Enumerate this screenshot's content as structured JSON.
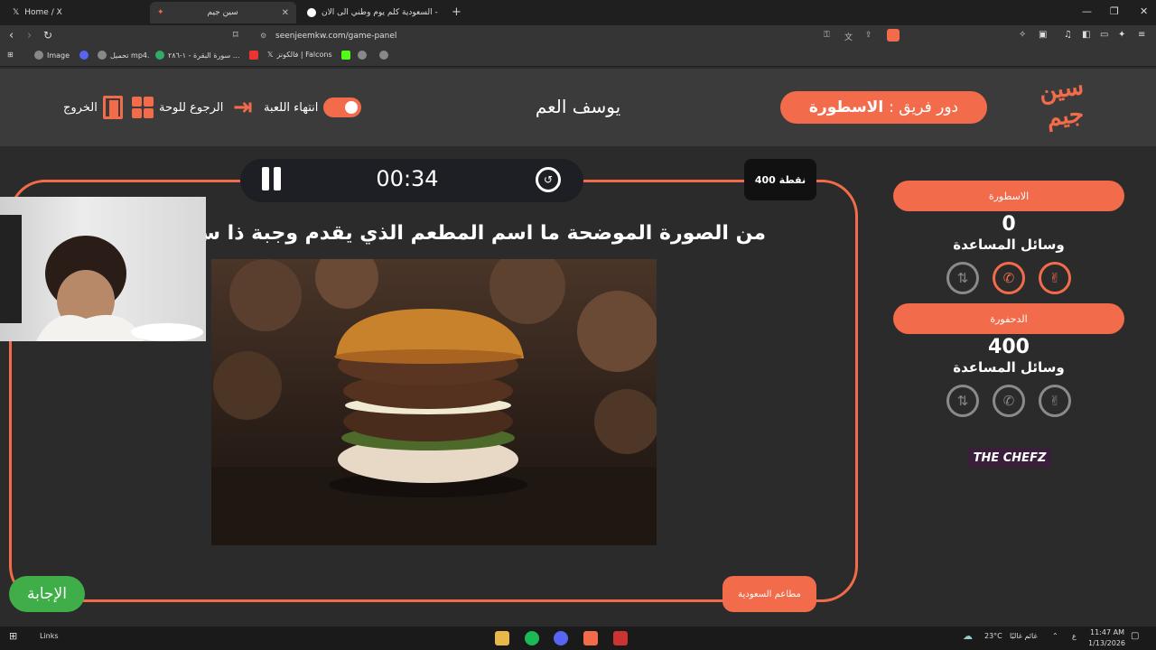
{
  "browser": {
    "tabs": [
      {
        "label": "Home / X"
      },
      {
        "label": "سين جيم",
        "close": "✕"
      },
      {
        "label": "السعودية كلم يوم وطني الى الان - rch",
        "close": "✕"
      }
    ],
    "new_tab": "+",
    "url": "seenjeemkw.com/game-panel",
    "bookmarks": [
      "Image",
      "تحميل mp4.",
      "سورة البقرة - ١-٢٨٦ ...",
      "فالكونز | Falcons"
    ]
  },
  "header": {
    "logo_line1": "سين",
    "logo_line2": "جيم",
    "turn_prefix": "دور فريق :",
    "turn_team": "الاسطورة",
    "player_name": "يوسف العم",
    "end_game_label": "انتهاء اللعبة",
    "back_to_board_label": "الرجوع للوحة",
    "exit_label": "الخروج"
  },
  "question_panel": {
    "timer": "00:34",
    "points": "400 نقطة",
    "question": "من الصورة الموضحة ما اسم المطعم الذي يقدم وجبة ذا س",
    "answer_label": "الإجابة",
    "category_label": "مطاعم السعودية"
  },
  "teams": [
    {
      "name": "الاسطورة",
      "score": "0",
      "aids_label": "وسائل المساعدة"
    },
    {
      "name": "الدحفورة",
      "score": "400",
      "aids_label": "وسائل المساعدة"
    }
  ],
  "sponsor": "THE CHEFZ",
  "taskbar": {
    "links": "Links",
    "weather": "23°C",
    "weather_text": "غائم غالبًا",
    "time": "11:47 AM",
    "date": "1/13/2026",
    "lang": "ع"
  },
  "colors": {
    "accent": "#f26b4a",
    "answer": "#3fae49",
    "background": "#2b2b2b"
  }
}
